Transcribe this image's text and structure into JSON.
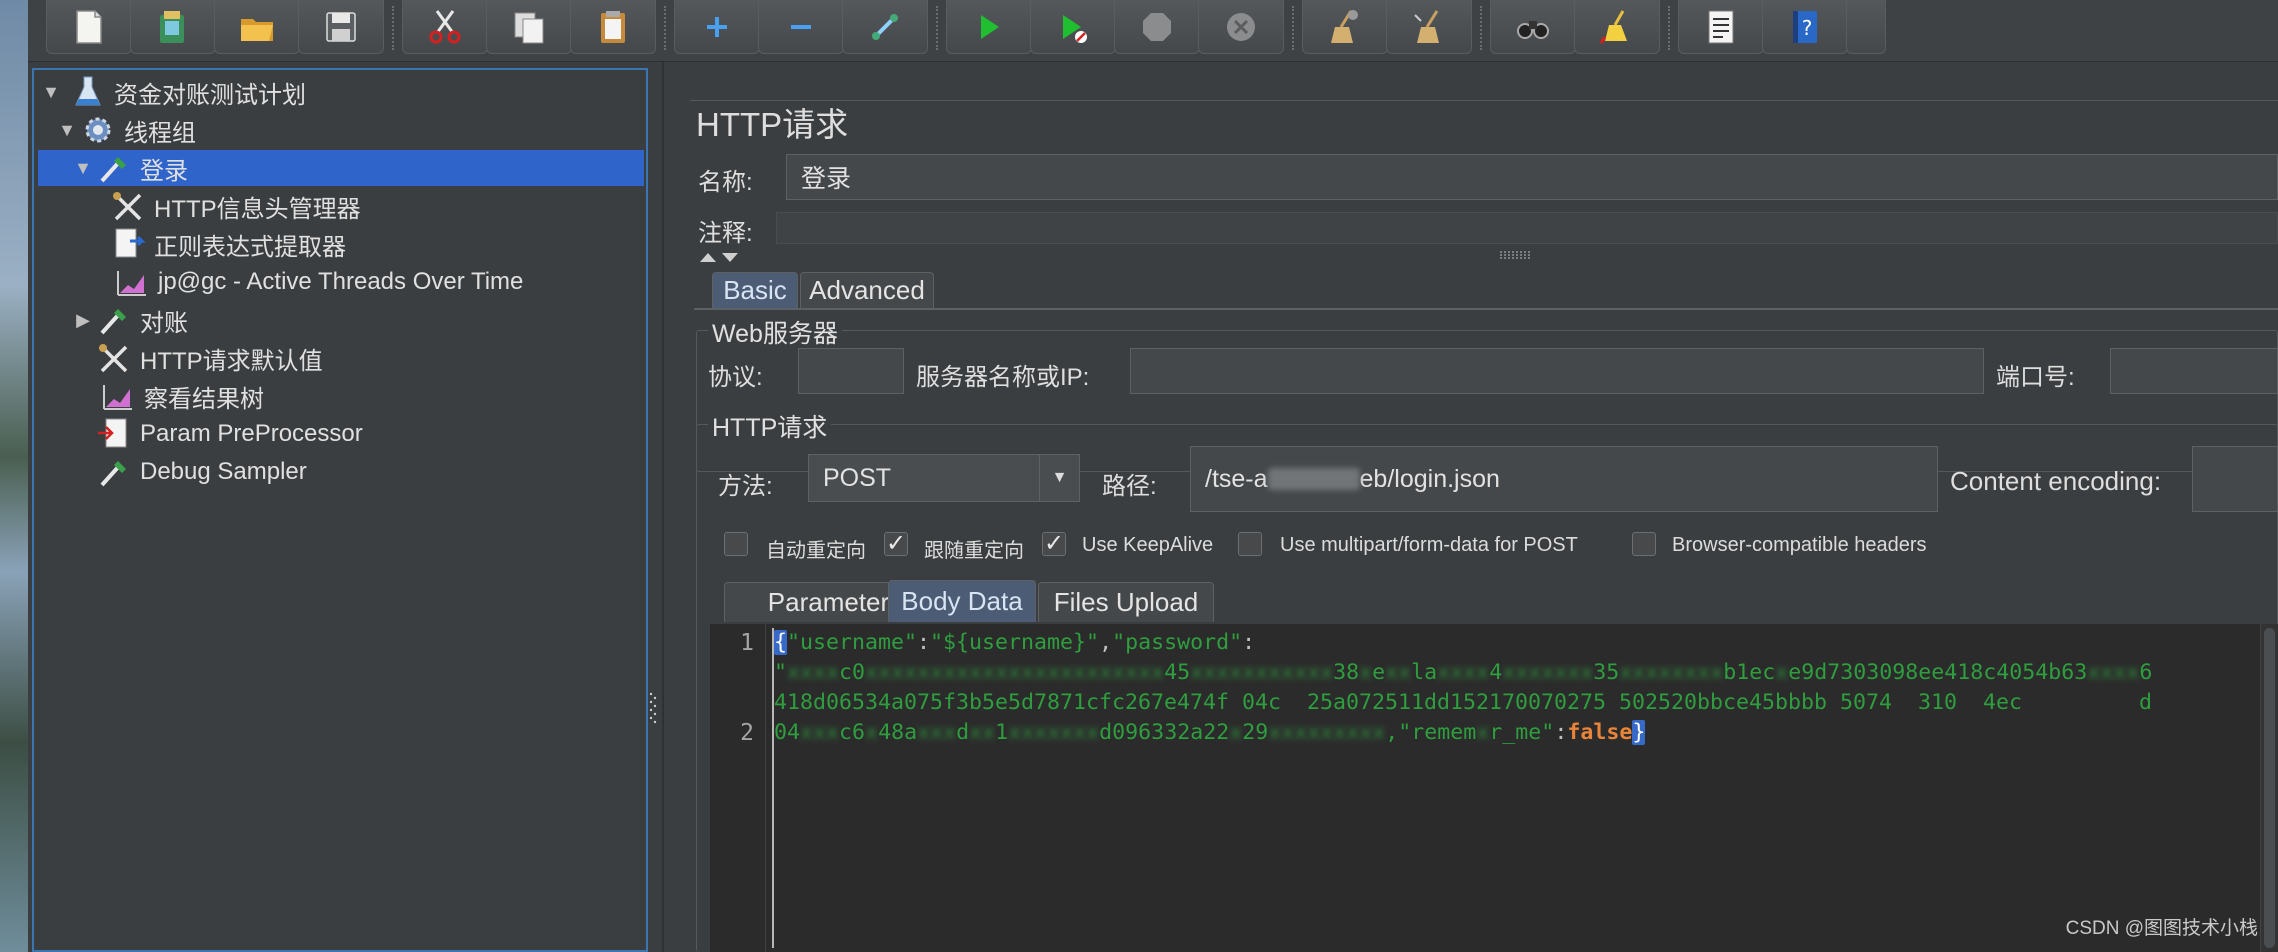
{
  "toolbar": {
    "buttons": [
      {
        "name": "new-plan-button",
        "icon": "new-document-icon"
      },
      {
        "name": "templates-button",
        "icon": "templates-icon"
      },
      {
        "name": "open-button",
        "icon": "open-folder-icon"
      },
      {
        "name": "save-button",
        "icon": "save-icon"
      },
      {
        "name": "cut-button",
        "icon": "scissors-icon"
      },
      {
        "name": "copy-button",
        "icon": "copy-icon"
      },
      {
        "name": "paste-button",
        "icon": "paste-icon"
      },
      {
        "name": "expand-all-button",
        "icon": "plus-icon"
      },
      {
        "name": "collapse-all-button",
        "icon": "minus-icon"
      },
      {
        "name": "toggle-button",
        "icon": "toggle-icon"
      },
      {
        "name": "start-button",
        "icon": "play-icon"
      },
      {
        "name": "start-no-pauses-button",
        "icon": "play-no-pause-icon"
      },
      {
        "name": "stop-button",
        "icon": "stop-icon"
      },
      {
        "name": "shutdown-button",
        "icon": "shutdown-icon"
      },
      {
        "name": "clear-button",
        "icon": "broom-icon"
      },
      {
        "name": "clear-all-button",
        "icon": "broom-all-icon"
      },
      {
        "name": "search-button",
        "icon": "binoculars-icon"
      },
      {
        "name": "reset-search-button",
        "icon": "reset-broom-icon"
      },
      {
        "name": "function-helper-button",
        "icon": "function-list-icon"
      },
      {
        "name": "help-button",
        "icon": "help-book-icon"
      }
    ]
  },
  "tree": {
    "items": [
      {
        "label": "资金对账测试计划",
        "icon": "test-plan-flask-icon",
        "level": 0,
        "toggle": "expanded"
      },
      {
        "label": "线程组",
        "icon": "gear-icon",
        "level": 1,
        "toggle": "expanded"
      },
      {
        "label": "登录",
        "icon": "pipette-sampler-icon",
        "level": 2,
        "toggle": "expanded",
        "selected": true
      },
      {
        "label": "HTTP信息头管理器",
        "icon": "tools-icon",
        "level": 3
      },
      {
        "label": "正则表达式提取器",
        "icon": "extractor-doc-icon",
        "level": 3
      },
      {
        "label": "jp@gc - Active Threads Over Time",
        "icon": "graph-icon",
        "level": 3
      },
      {
        "label": "对账",
        "icon": "pipette-sampler-icon",
        "level": 2,
        "toggle": "collapsed"
      },
      {
        "label": "HTTP请求默认值",
        "icon": "tools-icon",
        "level": 2
      },
      {
        "label": "察看结果树",
        "icon": "graph-icon",
        "level": 2
      },
      {
        "label": "Param PreProcessor",
        "icon": "preprocessor-doc-icon",
        "level": 2
      },
      {
        "label": "Debug Sampler",
        "icon": "pipette-sampler-icon",
        "level": 2
      }
    ]
  },
  "editor": {
    "title": "HTTP请求",
    "name_label": "名称:",
    "name_value": "登录",
    "comment_label": "注释:",
    "comment_value": "",
    "tabs": [
      {
        "label": "Basic",
        "active": true
      },
      {
        "label": "Advanced",
        "active": false
      }
    ],
    "web_server": {
      "group_label": "Web服务器",
      "protocol_label": "协议:",
      "protocol_value": "",
      "server_label": "服务器名称或IP:",
      "server_value": "",
      "port_label": "端口号:",
      "port_value": ""
    },
    "http_request": {
      "group_label": "HTTP请求",
      "method_label": "方法:",
      "method_value": "POST",
      "path_label": "路径:",
      "path_value_visible_start": "/tse-a",
      "path_value_visible_end": "eb/login.json",
      "encoding_label": "Content encoding:",
      "encoding_value": ""
    },
    "checkboxes": [
      {
        "label": "自动重定向",
        "checked": false
      },
      {
        "label": "跟随重定向",
        "checked": true
      },
      {
        "label": "Use KeepAlive",
        "checked": true
      },
      {
        "label": "Use multipart/form-data for POST",
        "checked": false
      },
      {
        "label": "Browser-compatible headers",
        "checked": false
      }
    ],
    "body_tabs": [
      {
        "label": "Parameters",
        "active": false
      },
      {
        "label": "Body Data",
        "active": true
      },
      {
        "label": "Files Upload",
        "active": false
      }
    ],
    "body": {
      "line_numbers": [
        "1",
        "2"
      ],
      "open_brace": "{",
      "key_username": "\"username\"",
      "colon": ":",
      "val_username": "\"${username}\"",
      "comma": ",",
      "key_password": "\"password\"",
      "pw_line1_a": "\"",
      "pw_line1_b": "c0",
      "pw_line1_c": "45",
      "pw_line1_d": "38",
      "pw_line1_e": "e",
      "pw_line1_f": "la",
      "pw_line1_g": "4",
      "pw_line1_h": "35",
      "pw_line1_i": "b1ec",
      "pw_line1_j": "e9d7303098ee418c4054b63",
      "pw_line1_k": "6",
      "pw_line2": "418d06534a075f3b5e5d7871cfc267e474f 04c  25a072511dd152170070275 502520bbce45bbbb 5074  310  4ec         d",
      "pw_line3_a": "04",
      "pw_line3_b": "c6",
      "pw_line3_c": "48a",
      "pw_line3_d": "d",
      "pw_line3_e": "1",
      "pw_line3_f": "d0",
      "pw_line3_g": "963",
      "pw_line3_h": "32a22",
      "pw_line3_i": "29",
      "key_remember_a": "\"remem",
      "key_remember_b": "r_me\"",
      "val_false": "false",
      "close_brace": "}"
    }
  },
  "watermark": "CSDN @图图技术小栈"
}
